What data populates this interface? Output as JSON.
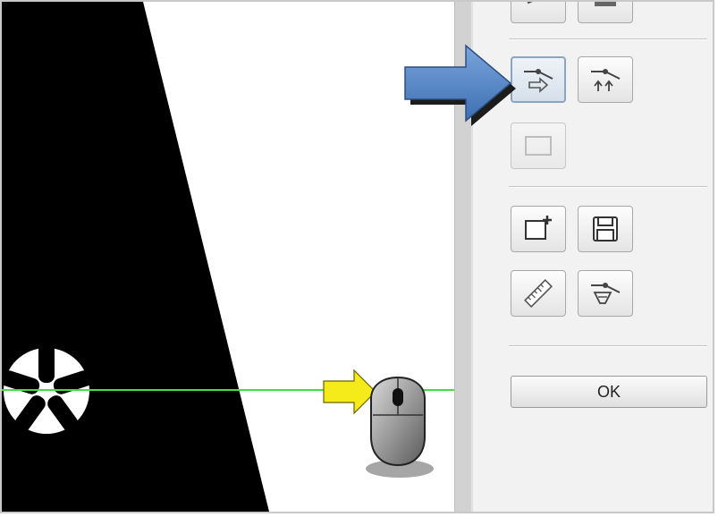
{
  "panel": {
    "ok_label": "OK"
  },
  "toolbar_icons": [
    "partial-tool-icon",
    "partial-tool-icon",
    "focus-arrow-icon",
    "focus-up-arrows-icon",
    "frame-icon",
    "new-image-icon",
    "save-icon",
    "ruler-icon",
    "focus-funnel-icon"
  ],
  "colors": {
    "guide_line": "#44dd44",
    "callout_blue": "#4f7fc0",
    "callout_yellow": "#f5ea1a",
    "panel_bg": "#f2f2f2"
  }
}
